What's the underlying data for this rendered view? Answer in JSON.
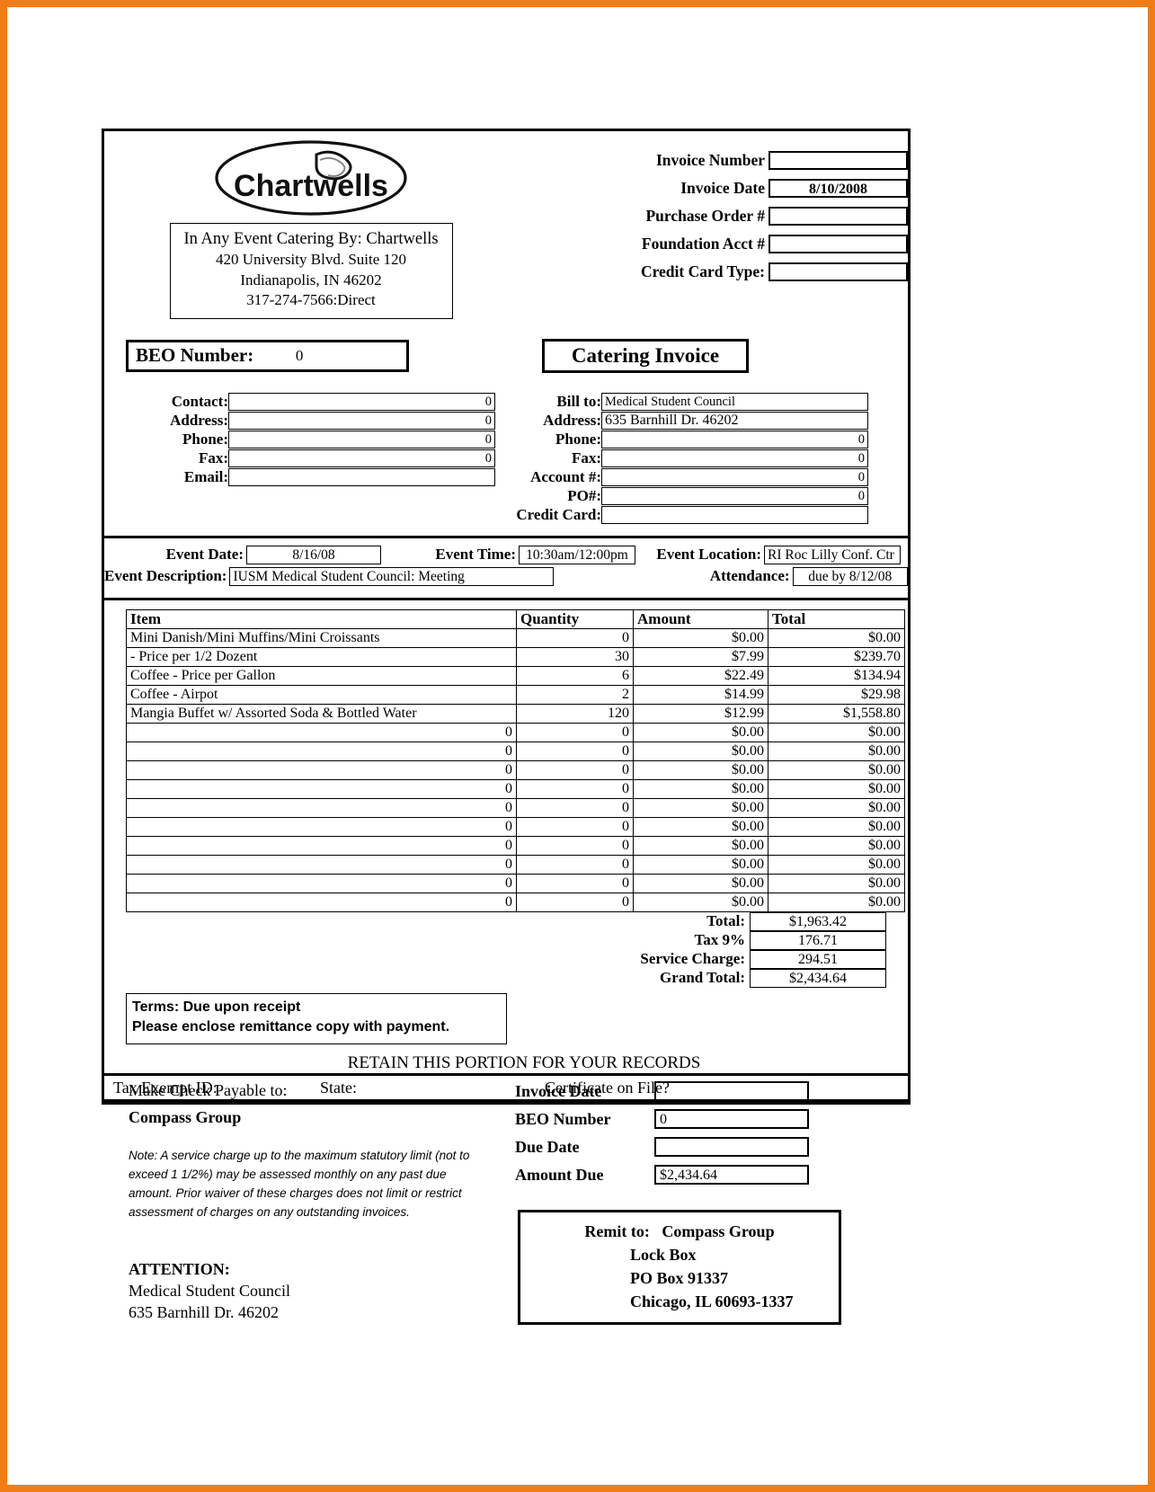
{
  "company": {
    "logo_text": "Chartwells",
    "address_lines": [
      "In Any Event Catering By: Chartwells",
      "420 University Blvd. Suite 120",
      "Indianapolis, IN 46202",
      "317-274-7566:Direct"
    ]
  },
  "header_fields": [
    {
      "label": "Invoice Number",
      "value": ""
    },
    {
      "label": "Invoice Date",
      "value": "8/10/2008"
    },
    {
      "label": "Purchase Order #",
      "value": ""
    },
    {
      "label": "Foundation Acct #",
      "value": ""
    },
    {
      "label": "Credit Card Type:",
      "value": ""
    }
  ],
  "beo": {
    "label": "BEO Number:",
    "value": "0"
  },
  "doc_title": "Catering Invoice",
  "contact": {
    "rows": [
      {
        "label": "Contact:",
        "value": "0"
      },
      {
        "label": "Address:",
        "value": "0"
      },
      {
        "label": "Phone:",
        "value": "0"
      },
      {
        "label": "Fax:",
        "value": "0"
      },
      {
        "label": "Email:",
        "value": ""
      }
    ]
  },
  "billto": {
    "rows": [
      {
        "label": "Bill to:",
        "value": "Medical Student Council"
      },
      {
        "label": "Address:",
        "value": "635 Barnhill Dr. 46202"
      },
      {
        "label": "Phone:",
        "value": "0"
      },
      {
        "label": "Fax:",
        "value": "0"
      },
      {
        "label": "Account #:",
        "value": "0"
      },
      {
        "label": "PO#:",
        "value": "0"
      },
      {
        "label": "Credit Card:",
        "value": ""
      }
    ]
  },
  "event": {
    "date_label": "Event Date:",
    "date_value": "8/16/08",
    "time_label": "Event Time:",
    "time_value": "10:30am/12:00pm",
    "location_label": "Event Location:",
    "location_value": "RI Roc Lilly Conf. Ctr",
    "description_label": "Event Description:",
    "description_value": "IUSM Medical Student Council: Meeting",
    "attendance_label": "Attendance:",
    "attendance_value": "due by 8/12/08"
  },
  "items_table": {
    "columns": [
      "Item",
      "Quantity",
      "Amount",
      "Total"
    ],
    "rows": [
      {
        "item": "Mini Danish/Mini Muffins/Mini Croissants",
        "qty": "0",
        "amount": "$0.00",
        "total": "$0.00"
      },
      {
        "item": " - Price per 1/2 Dozent",
        "qty": "30",
        "amount": "$7.99",
        "total": "$239.70"
      },
      {
        "item": "Coffee - Price per Gallon",
        "qty": "6",
        "amount": "$22.49",
        "total": "$134.94"
      },
      {
        "item": "Coffee - Airpot",
        "qty": "2",
        "amount": "$14.99",
        "total": "$29.98"
      },
      {
        "item": "Mangia Buffet w/ Assorted Soda & Bottled Water",
        "qty": "120",
        "amount": "$12.99",
        "total": "$1,558.80"
      },
      {
        "item": "0",
        "qty": "0",
        "amount": "$0.00",
        "total": "$0.00"
      },
      {
        "item": "0",
        "qty": "0",
        "amount": "$0.00",
        "total": "$0.00"
      },
      {
        "item": "0",
        "qty": "0",
        "amount": "$0.00",
        "total": "$0.00"
      },
      {
        "item": "0",
        "qty": "0",
        "amount": "$0.00",
        "total": "$0.00"
      },
      {
        "item": "0",
        "qty": "0",
        "amount": "$0.00",
        "total": "$0.00"
      },
      {
        "item": "0",
        "qty": "0",
        "amount": "$0.00",
        "total": "$0.00"
      },
      {
        "item": "0",
        "qty": "0",
        "amount": "$0.00",
        "total": "$0.00"
      },
      {
        "item": "0",
        "qty": "0",
        "amount": "$0.00",
        "total": "$0.00"
      },
      {
        "item": "0",
        "qty": "0",
        "amount": "$0.00",
        "total": "$0.00"
      },
      {
        "item": "0",
        "qty": "0",
        "amount": "$0.00",
        "total": "$0.00"
      }
    ]
  },
  "totals": [
    {
      "label": "Total:",
      "value": "$1,963.42"
    },
    {
      "label": "Tax 9%",
      "value": "176.71"
    },
    {
      "label": "Service Charge:",
      "value": "294.51"
    },
    {
      "label": "Grand Total:",
      "value": "$2,434.64"
    }
  ],
  "terms": {
    "line1": "Terms: Due upon receipt",
    "line2": "Please enclose remittance copy with payment."
  },
  "retain_notice": "RETAIN THIS PORTION FOR YOUR RECORDS",
  "tax_exempt": {
    "id_label": "Tax Exempt ID:",
    "state_label": "State:",
    "certificate_label": "Certificate on File?"
  },
  "footer": {
    "payable_label": "Make Check Payable to:",
    "payable_name": "Compass Group",
    "note": "Note: A service charge up to the maximum statutory limit (not to exceed 1 1/2%) may be assessed monthly on any past due amount. Prior waiver of these charges does not limit or restrict assessment of charges on any outstanding invoices.",
    "attention_label": "ATTENTION:",
    "attention_lines": [
      "Medical Student Council",
      "635 Barnhill Dr. 46202"
    ],
    "due_fields": [
      {
        "label": "Invoice Date",
        "value": ""
      },
      {
        "label": "BEO Number",
        "value": "0"
      },
      {
        "label": "Due Date",
        "value": ""
      },
      {
        "label": "Amount Due",
        "value": "$2,434.64"
      }
    ],
    "remit": {
      "label": "Remit to:",
      "name": "Compass Group",
      "lines": [
        "Lock Box",
        "PO Box 91337",
        "Chicago, IL 60693-1337"
      ]
    }
  },
  "colors": {
    "page_border": "#f07c17",
    "ink": "#000000",
    "paper": "#ffffff"
  }
}
